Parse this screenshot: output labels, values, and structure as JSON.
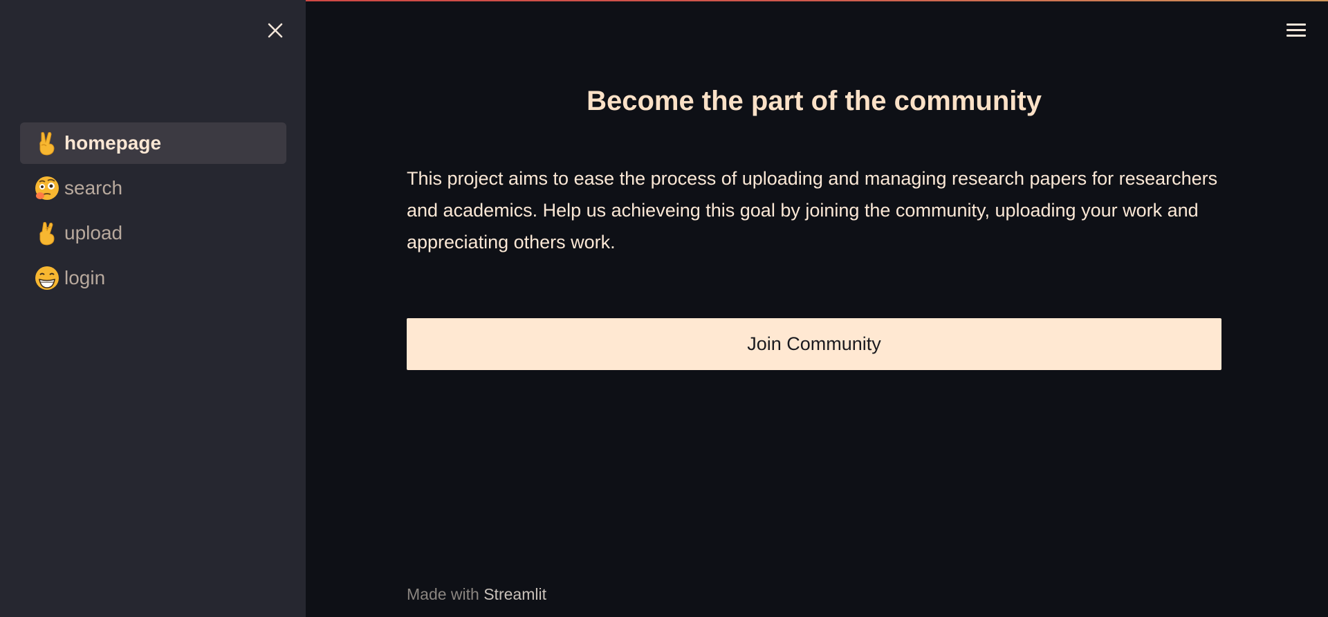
{
  "sidebar": {
    "items": [
      {
        "label": "homepage",
        "icon": "victory-hand-icon",
        "active": true
      },
      {
        "label": "search",
        "icon": "face-with-raised-eyebrow-icon",
        "active": false
      },
      {
        "label": "upload",
        "icon": "crossed-fingers-icon",
        "active": false
      },
      {
        "label": "login",
        "icon": "grinning-face-icon",
        "active": false
      }
    ]
  },
  "main": {
    "title": "Become the part of the community",
    "description": "This project aims to ease the process of uploading and managing research papers for researchers and academics. Help us achieveing this goal by joining the community, uploading your work and appreciating others work.",
    "join_button_label": "Join Community"
  },
  "footer": {
    "made_with": "Made with",
    "brand": "Streamlit"
  },
  "colors": {
    "background": "#0e1016",
    "sidebar_background": "#262730",
    "accent_text": "#fbe1c7",
    "button_background": "#ffe8d2"
  }
}
